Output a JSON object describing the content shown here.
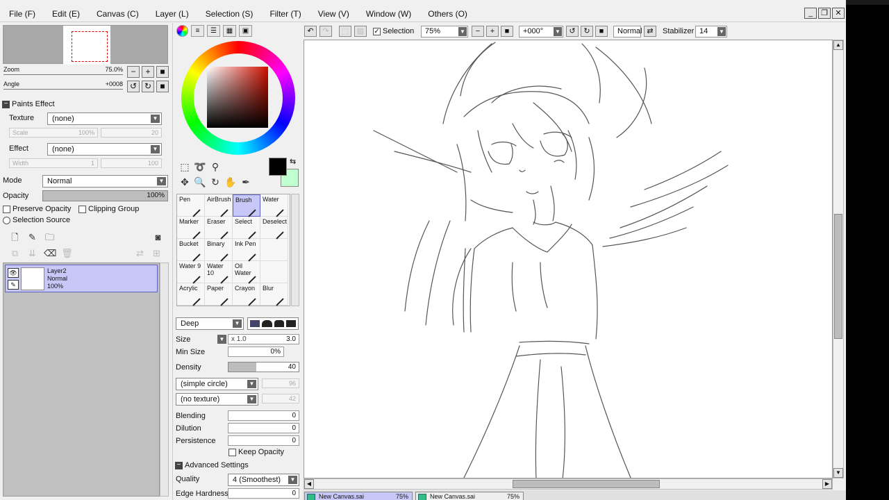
{
  "menu": [
    {
      "label": "File (F)"
    },
    {
      "label": "Edit (E)"
    },
    {
      "label": "Canvas (C)"
    },
    {
      "label": "Layer (L)"
    },
    {
      "label": "Selection (S)"
    },
    {
      "label": "Filter (T)"
    },
    {
      "label": "View (V)"
    },
    {
      "label": "Window (W)"
    },
    {
      "label": "Others (O)"
    }
  ],
  "window_buttons": {
    "minimize": "_",
    "restore": "❐",
    "close": "✕"
  },
  "navigator": {
    "zoom_label": "Zoom",
    "zoom_value": "75.0%",
    "angle_label": "Angle",
    "angle_value": "+0008",
    "zoom_out": "−",
    "zoom_in": "+",
    "zoom_reset": "■",
    "rotate_left": "↺",
    "rotate_right": "↻",
    "rotate_reset": "■"
  },
  "paints_effect": {
    "title": "Paints Effect",
    "texture_label": "Texture",
    "texture_value": "(none)",
    "scale_label": "Scale",
    "scale_value": "100%",
    "scale_extra": "20",
    "effect_label": "Effect",
    "effect_value": "(none)",
    "width_label": "Width",
    "width_value": "1",
    "width_extra": "100"
  },
  "layer_props": {
    "mode_label": "Mode",
    "mode_value": "Normal",
    "opacity_label": "Opacity",
    "opacity_value": "100%",
    "opacity_fraction": 1.0,
    "preserve_opacity": "Preserve Opacity",
    "clipping_group": "Clipping Group",
    "selection_source": "Selection Source"
  },
  "layers": [
    {
      "name": "Layer2",
      "mode": "Normal",
      "opacity": "100%"
    }
  ],
  "tool_tabs": [
    "color-wheel",
    "rgb-sliders",
    "hsv-sliders",
    "swatches",
    "scratchpad"
  ],
  "brushes": [
    {
      "label": "Pen"
    },
    {
      "label": "AirBrush"
    },
    {
      "label": "Brush"
    },
    {
      "label": "Water"
    },
    {
      "label": "Marker"
    },
    {
      "label": "Eraser"
    },
    {
      "label": "Select"
    },
    {
      "label": "Deselect"
    },
    {
      "label": "Bucket"
    },
    {
      "label": "Binary"
    },
    {
      "label": "Ink Pen"
    },
    {
      "label": ""
    },
    {
      "label": "Water 9"
    },
    {
      "label": "Water 10"
    },
    {
      "label": "Oil Water"
    },
    {
      "label": ""
    },
    {
      "label": "Acrylic"
    },
    {
      "label": "Paper"
    },
    {
      "label": "Crayon"
    },
    {
      "label": "Blur"
    }
  ],
  "active_brush": "Brush",
  "brush_settings": {
    "shape_value": "Deep",
    "size_label": "Size",
    "size_mult": "x 1.0",
    "size_value": "3.0",
    "min_size_label": "Min Size",
    "min_size_value": "0%",
    "density_label": "Density",
    "density_value": "40",
    "density_fraction": 0.4,
    "brush_shape": "(simple circle)",
    "brush_shape_value": "96",
    "texture": "(no texture)",
    "texture_value": "42",
    "blending_label": "Blending",
    "blending_value": "0",
    "dilution_label": "Dilution",
    "dilution_value": "0",
    "persistence_label": "Persistence",
    "persistence_value": "0",
    "keep_opacity": "Keep Opacity",
    "advanced": "Advanced Settings",
    "quality_label": "Quality",
    "quality_value": "4 (Smoothest)",
    "edge_hardness_label": "Edge Hardness",
    "edge_hardness_value": "0"
  },
  "canvas_toolbar": {
    "selection_label": "Selection",
    "zoom_value": "75%",
    "angle_value": "+000°",
    "blend_mode": "Normal",
    "stabilizer_label": "Stabilizer",
    "stabilizer_value": "14"
  },
  "doc_tabs": [
    {
      "name": "New Canvas.sai",
      "zoom": "75%"
    },
    {
      "name": "New Canvas.sai",
      "zoom": "75%"
    }
  ],
  "colors": {
    "primary": "#000000",
    "secondary": "#c0ffd0",
    "selection": "#c8c8f8"
  }
}
